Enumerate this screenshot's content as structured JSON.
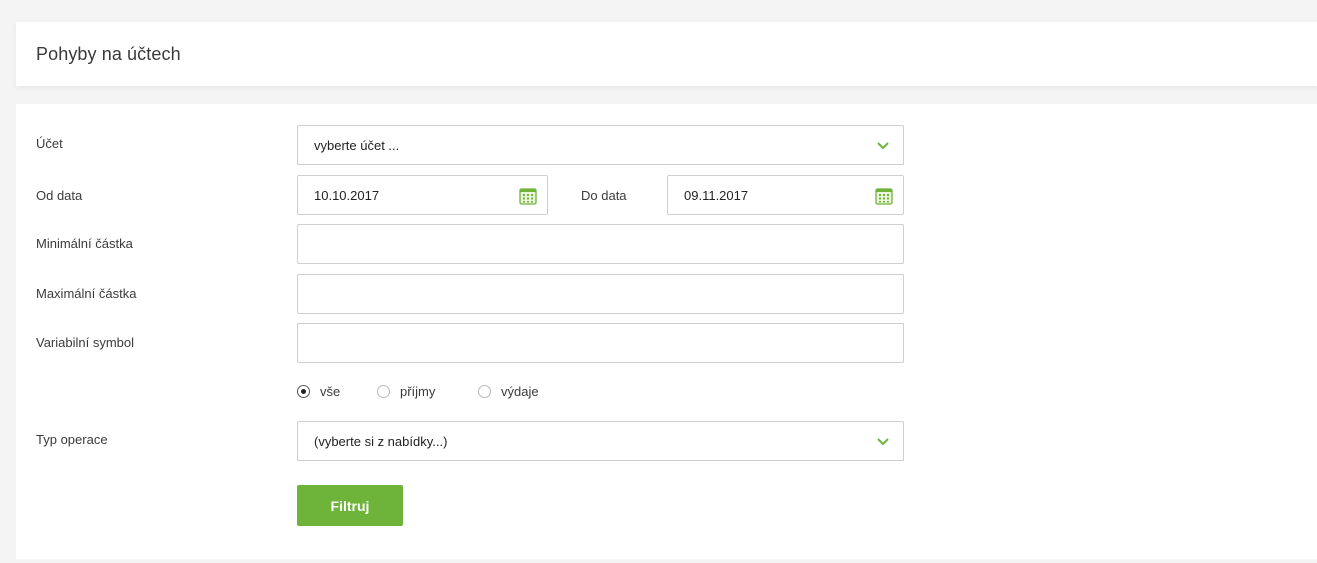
{
  "header": {
    "title": "Pohyby na účtech"
  },
  "form": {
    "ucet": {
      "label": "Účet",
      "value": "vyberte účet ..."
    },
    "od_data": {
      "label": "Od data",
      "value": "10.10.2017"
    },
    "do_data": {
      "label": "Do data",
      "value": "09.11.2017"
    },
    "min_castka": {
      "label": "Minimální částka",
      "value": ""
    },
    "max_castka": {
      "label": "Maximální částka",
      "value": ""
    },
    "var_symbol": {
      "label": "Variabilní symbol",
      "value": ""
    },
    "direction": {
      "options": [
        "vše",
        "příjmy",
        "výdaje"
      ],
      "selected": "vše"
    },
    "typ_operace": {
      "label": "Typ operace",
      "value": "(vyberte si z nabídky...)"
    },
    "submit_label": "Filtruj"
  },
  "icons": {
    "dropdown": "chevron-down-icon",
    "date_picker": "calendar-icon"
  },
  "colors": {
    "accent": "#6fb43a",
    "page_bg": "#f4f4f4",
    "card_bg": "#ffffff",
    "border": "#cfcfcf"
  }
}
